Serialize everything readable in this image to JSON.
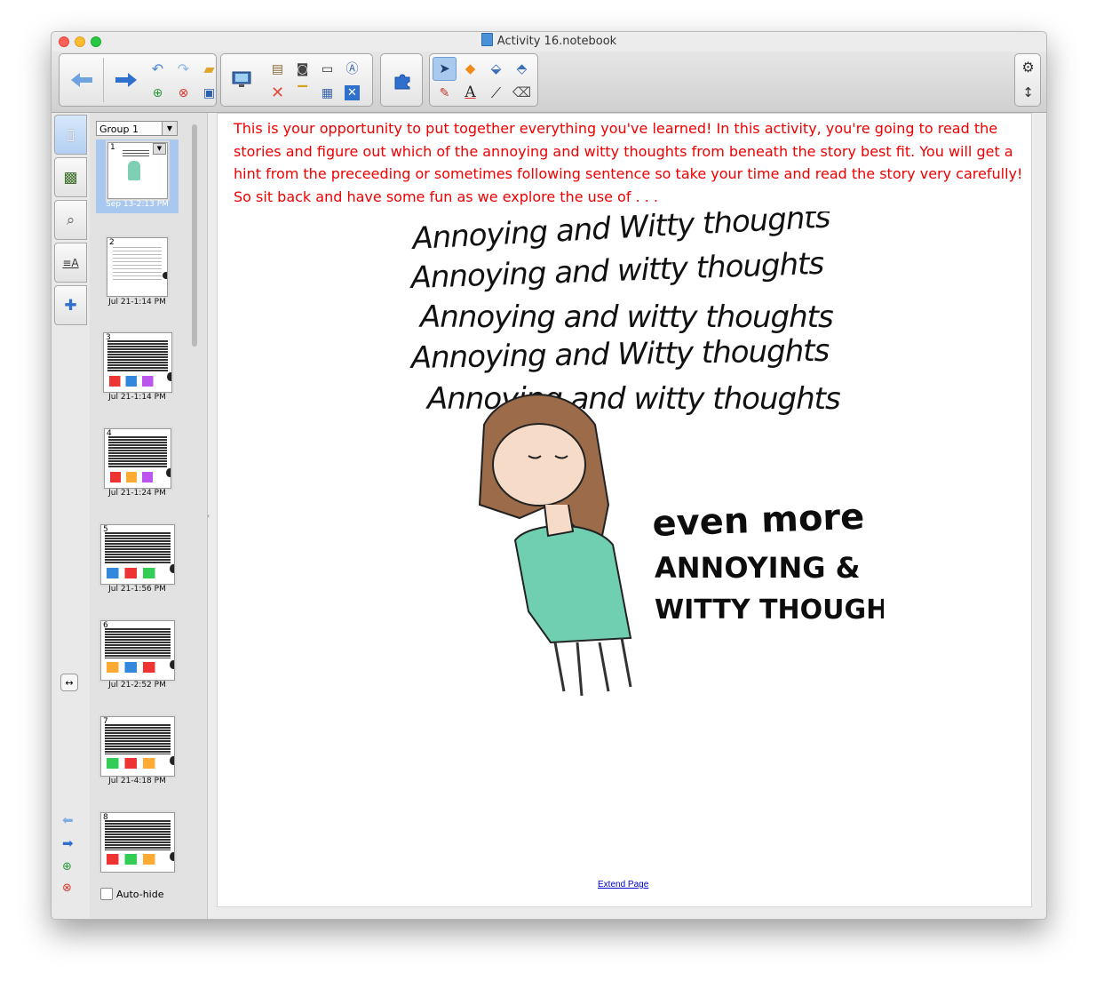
{
  "window": {
    "title": "Activity 16.notebook"
  },
  "toolbar": {
    "back_icon": "back-arrow-icon",
    "forward_icon": "forward-arrow-icon",
    "colors": {
      "arrow": "#2f6fce",
      "delete": "#e04a3a"
    }
  },
  "sorter": {
    "group": "Group 1",
    "autohide_label": "Auto-hide",
    "pages": [
      {
        "num": "1",
        "date": "Sep 13-2:13 PM"
      },
      {
        "num": "2",
        "date": "Jul 21-1:14 PM"
      },
      {
        "num": "3",
        "date": "Jul 21-1:14 PM"
      },
      {
        "num": "4",
        "date": "Jul 21-1:24 PM"
      },
      {
        "num": "5",
        "date": "Jul 21-1:56 PM"
      },
      {
        "num": "6",
        "date": "Jul 21-2:52 PM"
      },
      {
        "num": "7",
        "date": "Jul 21-4:18 PM"
      },
      {
        "num": "8",
        "date": ""
      }
    ]
  },
  "page": {
    "intro_text": "This is your opportunity to put together everything you've learned!  In this activity, you're going to read the stories and figure out which of the annoying and witty thoughts from beneath the story best fit.  You will get a hint from the preceeding or sometimes following sentence so take your time and read the story very carefully!  So sit back and have some fun as we explore the use of . . .",
    "heading_lines": [
      "Annoying and Witty thoughts",
      "Annoying and witty thoughts",
      "Annoying and witty thoughts",
      "Annoying and Witty thoughts",
      "Annoying and witty thoughts"
    ],
    "sub_lines": [
      "even more",
      "ANNOYING &",
      "WITTY THOUGHTS"
    ],
    "extend_link": "Extend Page",
    "text_color": "#f00000"
  }
}
